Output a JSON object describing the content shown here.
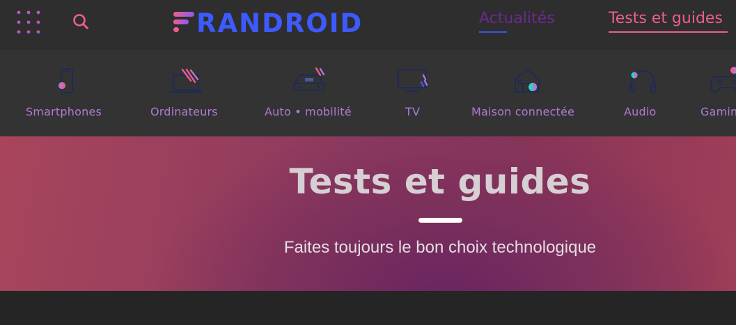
{
  "header": {
    "logo_text": "FRANDROID",
    "nav": [
      {
        "label": "Actualités"
      },
      {
        "label": "Tests et guides"
      }
    ],
    "icons": {
      "menu": "grid-dots-icon",
      "search": "search-icon"
    }
  },
  "categories": [
    {
      "label": "Smartphones",
      "icon": "smartphone-icon"
    },
    {
      "label": "Ordinateurs",
      "icon": "laptop-icon"
    },
    {
      "label": "Auto • mobilité",
      "icon": "car-icon"
    },
    {
      "label": "TV",
      "icon": "tv-icon"
    },
    {
      "label": "Maison connectée",
      "icon": "smart-home-icon"
    },
    {
      "label": "Audio",
      "icon": "headphones-icon"
    },
    {
      "label": "Gaming",
      "icon": "gamepad-icon"
    }
  ],
  "hero": {
    "title": "Tests et guides",
    "subtitle": "Faites toujours le bon choix technologique"
  },
  "colors": {
    "header_bg": "#2e2e2e",
    "catbar_bg": "#333333",
    "logo_blue": "#3d5afe",
    "active_pink": "#ee5d93",
    "category_purple": "#b07ad4",
    "hero_red": "#a8455c",
    "hero_purple": "#6a2560"
  }
}
